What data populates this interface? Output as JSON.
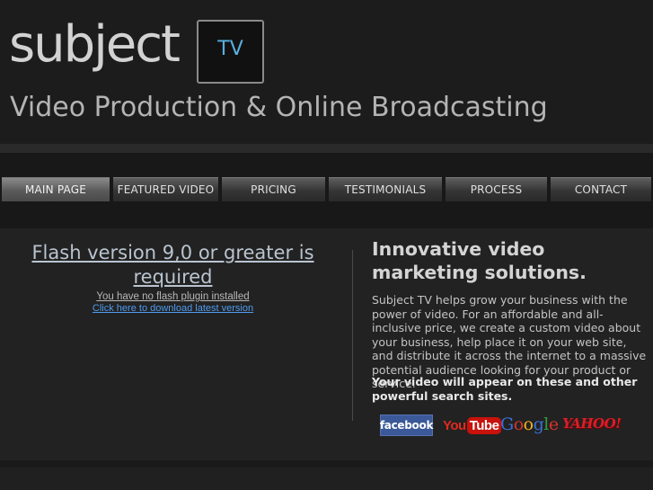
{
  "header": {
    "logo_word": "subject",
    "logo_badge": "TV",
    "tagline": "Video Production & Online Broadcasting"
  },
  "nav": {
    "items": [
      {
        "label": "MAIN PAGE",
        "active": true
      },
      {
        "label": "FEATURED VIDEO",
        "active": false
      },
      {
        "label": "PRICING",
        "active": false
      },
      {
        "label": "TESTIMONIALS",
        "active": false
      },
      {
        "label": "PROCESS",
        "active": false
      },
      {
        "label": "CONTACT",
        "active": false
      }
    ]
  },
  "flash": {
    "title": "Flash version 9,0 or greater is required",
    "message": "You have no flash plugin installed",
    "link": "Click here to download latest version"
  },
  "content": {
    "heading": "Innovative video marketing solutions.",
    "body": "Subject TV helps grow your business with the power of video. For an affordable and all-inclusive price, we create a custom video about your business, help place it on your web site, and distribute it across the internet to a massive potential audience looking for your product or service.",
    "overlap": "Your video will appear on these and other powerful search sites."
  },
  "partners": {
    "facebook": "facebook",
    "youtube_you": "You",
    "youtube_tube": "Tube",
    "google": [
      "G",
      "o",
      "o",
      "g",
      "l",
      "e"
    ],
    "yahoo": "YAHOO!"
  },
  "colors": {
    "accent_blue": "#5aaee0",
    "link_blue": "#4f9bf0",
    "facebook_blue": "#3b5998",
    "youtube_red": "#c8120c",
    "google_colors": [
      "#3a6fd8",
      "#d8322a",
      "#f2b21c",
      "#3a6fd8",
      "#2f9e44",
      "#d8322a"
    ],
    "yahoo_red": "#d4202a"
  }
}
